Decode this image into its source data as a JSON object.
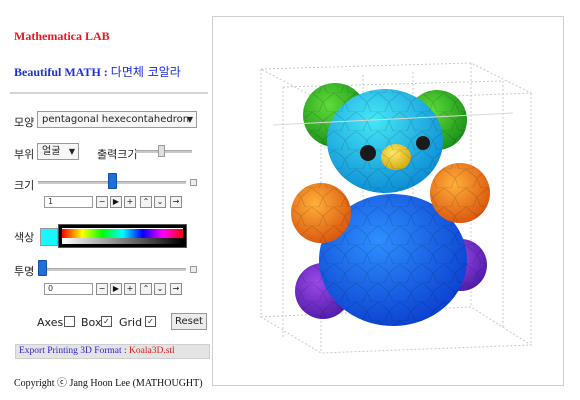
{
  "app": {
    "title": "Mathematica LAB",
    "subtitle_prefix": "Beautiful MATH :",
    "subtitle_suffix": "다면체 코알라"
  },
  "controls": {
    "shape_label": "모양",
    "shape_value": "pentagonal hexecontahedron",
    "part_label": "부위",
    "part_value": "얼굴",
    "output_size_label": "출력크기",
    "size_label": "크기",
    "size_value": "1",
    "size_level": 0.5,
    "color_label": "색상",
    "color_value": "#17f7ff",
    "opacity_label": "투명",
    "opacity_value": "0",
    "opacity_level": 0.0,
    "buttons": [
      "−",
      "▶",
      "+",
      "⌃",
      "⌄",
      "→"
    ]
  },
  "options": {
    "axes_label": "Axes",
    "axes_checked": false,
    "box_label": "Box",
    "box_checked": true,
    "grid_label": "Grid",
    "grid_checked": true,
    "reset_label": "Reset"
  },
  "export": {
    "label": "Export Printing 3D Format :",
    "filename": "Koala3D.stl"
  },
  "footer": {
    "copyright": "Copyright ⓒ Jang Hoon Lee (MATHOUGHT)"
  }
}
